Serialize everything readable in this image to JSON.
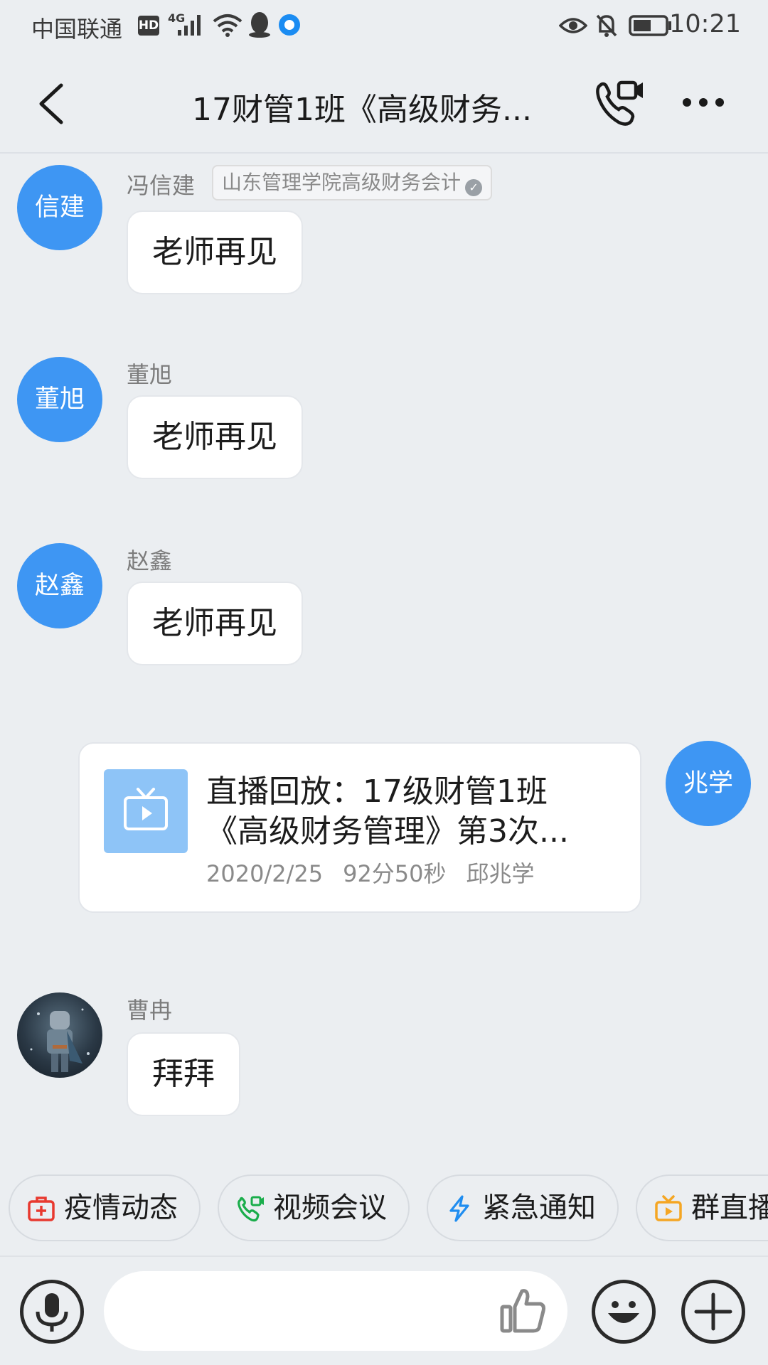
{
  "status_bar": {
    "carrier": "中国联通",
    "hd": "HD",
    "network": "4G",
    "time": "10:21",
    "icons": [
      "hd-icon",
      "signal-icon",
      "wifi-icon",
      "qq-icon",
      "browser-icon",
      "eye-icon",
      "mute-bell-icon",
      "battery-icon"
    ]
  },
  "header": {
    "title": "17财管1班《高级财务...",
    "icons": [
      "back-icon",
      "video-call-icon",
      "more-icon"
    ]
  },
  "messages": [
    {
      "avatar_text": "信建",
      "sender": "冯信建",
      "tag": "山东管理学院高级财务会计",
      "text": "老师再见"
    },
    {
      "avatar_text": "董旭",
      "sender": "董旭",
      "text": "老师再见"
    },
    {
      "avatar_text": "赵鑫",
      "sender": "赵鑫",
      "text": "老师再见"
    },
    {
      "avatar_text": "兆学",
      "card": {
        "title_line1": "直播回放：17级财管1班",
        "title_line2": "《高级财务管理》第3次...",
        "date": "2020/2/25",
        "duration": "92分50秒",
        "host": "邱兆学",
        "icon": "tv-icon",
        "thumb_color": "#8ec4f7"
      }
    },
    {
      "sender": "曹冉",
      "text": "拜拜"
    }
  ],
  "chips": [
    {
      "label": "疫情动态",
      "icon": "medical-kit-icon",
      "color": "#e8392f"
    },
    {
      "label": "视频会议",
      "icon": "phone-video-icon",
      "color": "#1aad4b"
    },
    {
      "label": "紧急通知",
      "icon": "lightning-icon",
      "color": "#1f8df0"
    },
    {
      "label": "群直播",
      "icon": "live-tv-icon",
      "color": "#f5a623"
    }
  ],
  "input_bar": {
    "placeholder": "",
    "icons": [
      "microphone-icon",
      "thumbs-up-icon",
      "emoji-icon",
      "plus-icon"
    ]
  },
  "colors": {
    "background": "#ebeef1",
    "avatar_blue": "#3e96f3",
    "bubble": "#ffffff"
  }
}
